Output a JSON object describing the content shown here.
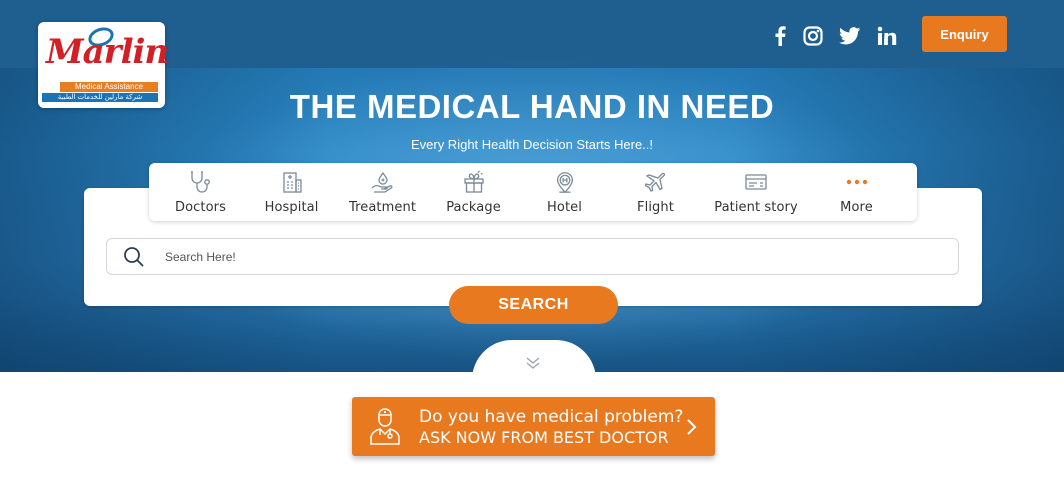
{
  "logo": {
    "name": "Marlin",
    "tagline": "Medical Assistance",
    "arabic_tagline": "شركة مارلين للخدمات الطبية"
  },
  "header": {
    "social": [
      "facebook-icon",
      "instagram-icon",
      "twitter-icon",
      "linkedin-icon"
    ],
    "enquiry_label": "Enquiry"
  },
  "hero": {
    "title": "THE MEDICAL HAND IN NEED",
    "subtitle": "Every Right Health Decision Starts Here..!"
  },
  "tabs": [
    {
      "label": "Doctors",
      "icon": "stethoscope-icon"
    },
    {
      "label": "Hospital",
      "icon": "hospital-building-icon"
    },
    {
      "label": "Treatment",
      "icon": "hand-drop-icon"
    },
    {
      "label": "Package",
      "icon": "gift-box-icon"
    },
    {
      "label": "Hotel",
      "icon": "hotel-pin-icon"
    },
    {
      "label": "Flight",
      "icon": "airplane-icon"
    },
    {
      "label": "Patient story",
      "icon": "id-card-icon"
    },
    {
      "label": "More",
      "icon": "more-dots-icon"
    }
  ],
  "search": {
    "placeholder": "Search Here!",
    "button_label": "SEARCH"
  },
  "cta": {
    "line1": "Do you have medical problem?",
    "line2": "ASK NOW FROM BEST DOCTOR"
  },
  "colors": {
    "accent": "#e8791f",
    "brand_blue": "#1a74b8",
    "brand_red": "#d32027"
  }
}
